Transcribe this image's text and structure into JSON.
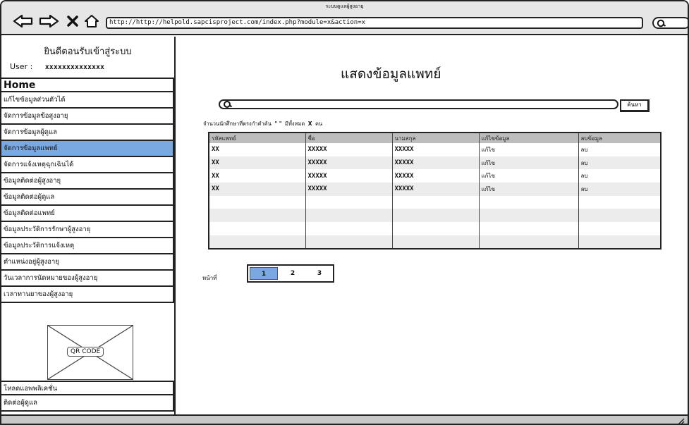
{
  "browser": {
    "window_title": "ระบบดูแลผู้สูงอายุ",
    "url": "http://http://helpold.sapcisproject.com/index.php?module=x&action=x"
  },
  "sidebar": {
    "welcome": "ยินดีตอนรับเข้าสู่ระบบ",
    "user_label": "User :",
    "user_value": "xxxxxxxxxxxxxx",
    "items": [
      {
        "label": "Home"
      },
      {
        "label": "แก้ไขข้อมูลส่วนตัวได้"
      },
      {
        "label": "จัดการข้อมูลข้อสูงอายุ"
      },
      {
        "label": "จัดการข้อมูลผู้ดูแล"
      },
      {
        "label": "จัดการข้อมูลแพทย์"
      },
      {
        "label": "จัดการแจ้งเหตุฉุกเฉินได้"
      },
      {
        "label": "ข้อมูลติดต่อผู้สูงอายุ"
      },
      {
        "label": "ข้อมูลติดต่อผู้ดูแล"
      },
      {
        "label": "ข้อมูลติดต่อแพทย์"
      },
      {
        "label": "ข้อมูลประวัติการรักษาผู้สูงอายุ"
      },
      {
        "label": "ข้อมูลประวัติการแจ้งเหตุ"
      },
      {
        "label": "ตำแหน่งอยู่ผู้สูงอายุ"
      },
      {
        "label": "วันเวลาการนัดหมายของผู้สูงอายุ"
      },
      {
        "label": "เวลาทานยาของผู้สูงอายุ"
      }
    ],
    "active_index": 4,
    "qr_label": "QR CODE",
    "bottom_items": [
      {
        "label": "โหลดแอพพลิเคชั่น"
      },
      {
        "label": "ติดต่อผู้ดูแล"
      }
    ]
  },
  "main": {
    "title": "แสดงข้อมูลแพทย์",
    "search": {
      "value": "",
      "button_label": "ค้นหา"
    },
    "count_prefix": "จำนวนนักศึกษาที่ตรงกำคำค้น",
    "count_query": "\" \"",
    "count_middle": "มีทั้งหมด",
    "count_value": "X",
    "count_suffix": "คน",
    "table": {
      "headers": [
        "รหัสแพทย์",
        "ชื่อ",
        "นามสกุล",
        "แก้ไขข้อมูล",
        "ลบข้อมูล"
      ],
      "rows": [
        [
          "XX",
          "XXXXX",
          "XXXXX",
          "แก้ไข",
          "ลบ"
        ],
        [
          "XX",
          "XXXXX",
          "XXXXX",
          "แก้ไข",
          "ลบ"
        ],
        [
          "XX",
          "XXXXX",
          "XXXXX",
          "แก้ไข",
          "ลบ"
        ],
        [
          "XX",
          "XXXXX",
          "XXXXX",
          "แก้ไข",
          "ลบ"
        ],
        [
          "",
          "",
          "",
          "",
          ""
        ],
        [
          "",
          "",
          "",
          "",
          ""
        ],
        [
          "",
          "",
          "",
          "",
          ""
        ],
        [
          "",
          "",
          "",
          "",
          ""
        ]
      ]
    },
    "pagination": {
      "label": "หน้าที่",
      "pages": [
        "1",
        "2",
        "3"
      ],
      "active": 0
    }
  },
  "colors": {
    "accent": "#7aa8e0",
    "header_gray": "#bdbdbd",
    "chrome_gray": "#e6e6e6"
  }
}
